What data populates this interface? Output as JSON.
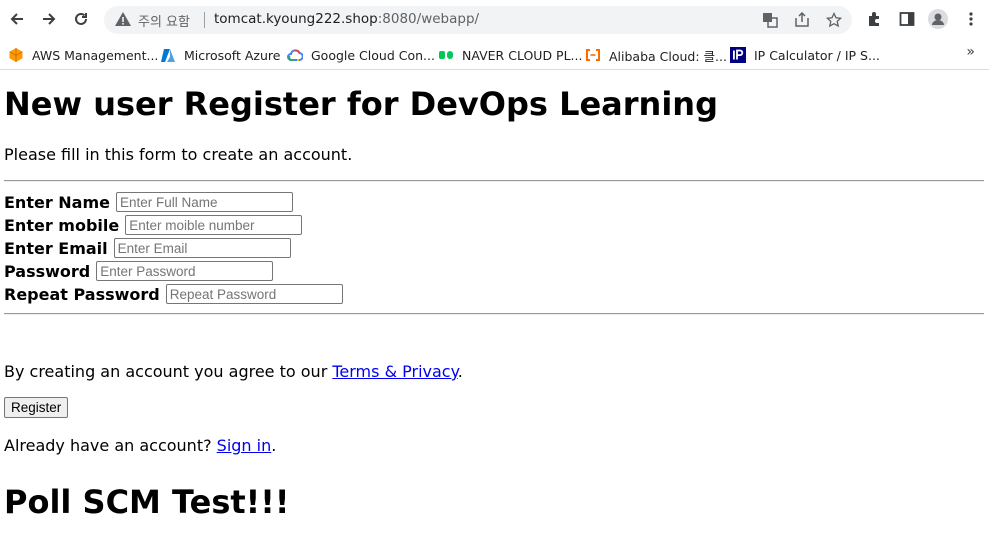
{
  "browser": {
    "security_status": "주의 요함",
    "url_host": "tomcat.kyoung222.shop",
    "url_path": ":8080/webapp/"
  },
  "bookmarks": [
    {
      "label": "AWS Management...",
      "color": "#ff9900",
      "icon": "aws-icon"
    },
    {
      "label": "Microsoft Azure",
      "color": "#0078d4",
      "icon": "azure-icon"
    },
    {
      "label": "Google Cloud Con...",
      "color": "#4285f4",
      "icon": "google-cloud-icon"
    },
    {
      "label": "NAVER CLOUD PL...",
      "color": "#03c75a",
      "icon": "naver-cloud-icon"
    },
    {
      "label": "Alibaba Cloud: 클...",
      "color": "#ff6a00",
      "icon": "alibaba-cloud-icon"
    },
    {
      "label": "IP Calculator / IP S...",
      "color": "#000080",
      "icon": "ip-calculator-icon"
    }
  ],
  "page": {
    "title": "New user Register for DevOps Learning",
    "intro": "Please fill in this form to create an account.",
    "fields": [
      {
        "label": "Enter Name",
        "placeholder": "Enter Full Name"
      },
      {
        "label": "Enter mobile",
        "placeholder": "Enter moible number"
      },
      {
        "label": "Enter Email",
        "placeholder": "Enter Email"
      },
      {
        "label": "Password",
        "placeholder": "Enter Password"
      },
      {
        "label": "Repeat Password",
        "placeholder": "Repeat Password"
      }
    ],
    "terms_prefix": "By creating an account you agree to our ",
    "terms_link": "Terms & Privacy",
    "terms_suffix": ".",
    "register_label": "Register",
    "signin_prefix": "Already have an account? ",
    "signin_link": "Sign in",
    "signin_suffix": ".",
    "footer_title": "Poll SCM Test!!!"
  }
}
